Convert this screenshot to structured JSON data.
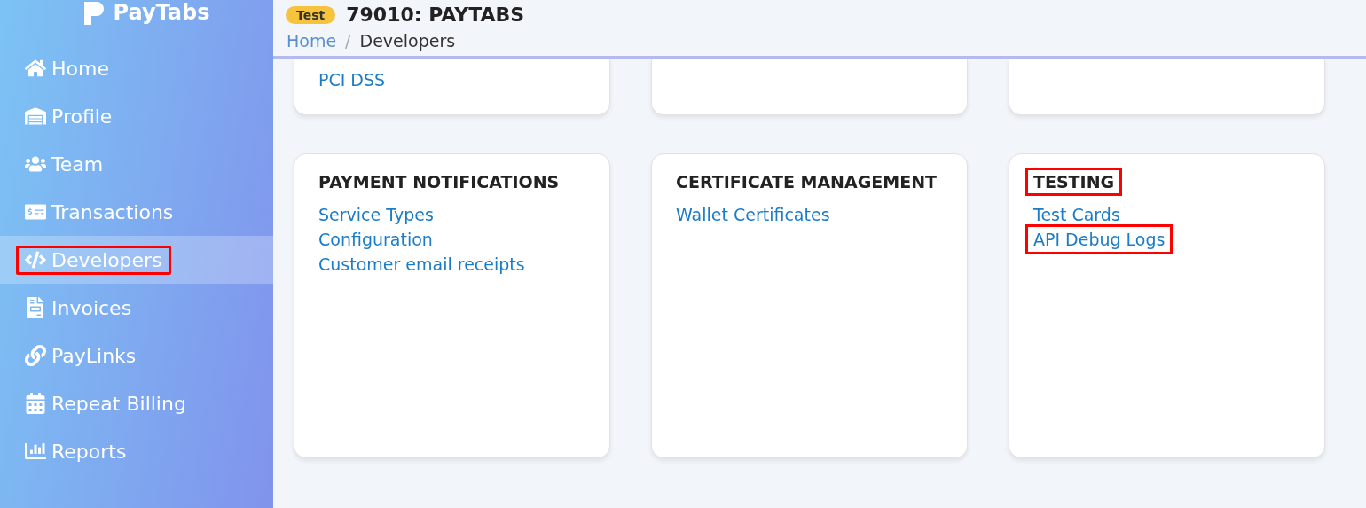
{
  "brand": {
    "name": "PayTabs"
  },
  "header": {
    "badge": "Test",
    "title": "79010: PAYTABS"
  },
  "sidebar": {
    "items": [
      {
        "label": "Home",
        "selected": false,
        "highlighted": false
      },
      {
        "label": "Profile",
        "selected": false,
        "highlighted": false
      },
      {
        "label": "Team",
        "selected": false,
        "highlighted": false
      },
      {
        "label": "Transactions",
        "selected": false,
        "highlighted": false
      },
      {
        "label": "Developers",
        "selected": true,
        "highlighted": true
      },
      {
        "label": "Invoices",
        "selected": false,
        "highlighted": false
      },
      {
        "label": "PayLinks",
        "selected": false,
        "highlighted": false
      },
      {
        "label": "Repeat Billing",
        "selected": false,
        "highlighted": false
      },
      {
        "label": "Reports",
        "selected": false,
        "highlighted": false
      }
    ]
  },
  "breadcrumb": [
    {
      "label": "Home",
      "kind": "link"
    },
    {
      "label": "Developers",
      "kind": "current",
      "separator": "/"
    }
  ],
  "top_cards": [
    {
      "kind": "links",
      "links": [
        {
          "label": "PCI DSS",
          "highlighted": false
        }
      ]
    },
    {
      "kind": "blank"
    },
    {
      "kind": "blank"
    }
  ],
  "cards": [
    {
      "title": "PAYMENT NOTIFICATIONS",
      "highlighted": false,
      "links": [
        {
          "label": "Service Types",
          "highlighted": false
        },
        {
          "label": "Configuration",
          "highlighted": false
        },
        {
          "label": "Customer email receipts",
          "highlighted": false
        }
      ]
    },
    {
      "title": "CERTIFICATE MANAGEMENT",
      "highlighted": false,
      "links": [
        {
          "label": "Wallet Certificates",
          "highlighted": false
        }
      ]
    },
    {
      "title": "TESTING",
      "highlighted": true,
      "links": [
        {
          "label": "Test Cards",
          "highlighted": false
        },
        {
          "label": "API Debug Logs",
          "highlighted": true
        }
      ]
    }
  ]
}
